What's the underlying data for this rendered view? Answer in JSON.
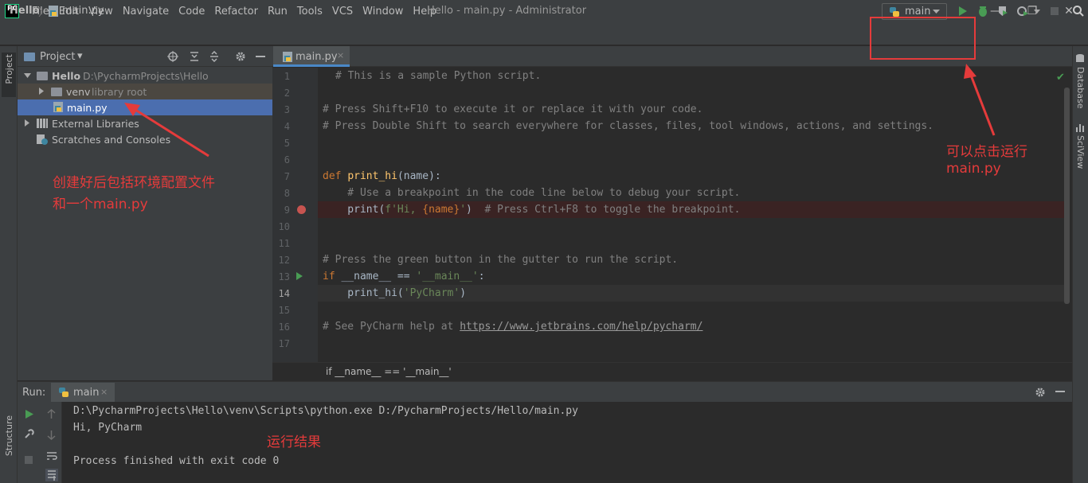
{
  "titlebar": {
    "app_logo": "PC",
    "menu": [
      "File",
      "Edit",
      "View",
      "Navigate",
      "Code",
      "Refactor",
      "Run",
      "Tools",
      "VCS",
      "Window",
      "Help"
    ],
    "window_title": "Hello - main.py - Administrator",
    "controls": {
      "minimize": "—",
      "restore": "❐",
      "close": "✕"
    }
  },
  "navbar": {
    "project": "Hello",
    "separator": "〉",
    "file": "main.py",
    "run_config": "main",
    "toolbar_icons": [
      "run-icon",
      "debug-icon",
      "coverage-icon",
      "profile-icon",
      "stop-icon",
      "search-icon"
    ]
  },
  "left_stripe": {
    "project": "Project",
    "structure": "Structure"
  },
  "project_panel": {
    "title": "Project",
    "dropdown": "▾",
    "tree": {
      "root_name": "Hello",
      "root_path": "D:\\PycharmProjects\\Hello",
      "venv_name": "venv",
      "venv_note": "library root",
      "main_file": "main.py",
      "external": "External Libraries",
      "scratches": "Scratches and Consoles"
    }
  },
  "editor": {
    "tab": "main.py",
    "tab_close": "×",
    "line_numbers": [
      "1",
      "2",
      "3",
      "4",
      "5",
      "6",
      "7",
      "8",
      "9",
      "10",
      "11",
      "12",
      "13",
      "14",
      "15",
      "16",
      "17"
    ],
    "lines": {
      "l1": "# This is a sample Python script.",
      "l3": "# Press Shift+F10 to execute it or replace it with your code.",
      "l4": "# Press Double Shift to search everywhere for classes, files, tool windows, actions, and settings.",
      "l7_kw": "def",
      "l7_fn": "print_hi",
      "l7_rest": "(name):",
      "l8": "    # Use a breakpoint in the code line below to debug your script.",
      "l9_call": "    print(",
      "l9_str1": "f'Hi, ",
      "l9_var": "{name}",
      "l9_str2": "'",
      "l9_close": ")  ",
      "l9_cmt": "# Press Ctrl+F8 to toggle the breakpoint.",
      "l12": "# Press the green button in the gutter to run the script.",
      "l13_kw": "if",
      "l13_rest": " __name__ == ",
      "l13_str": "'__main__'",
      "l13_colon": ":",
      "l14_call": "    print_hi(",
      "l14_str": "'PyCharm'",
      "l14_close": ")",
      "l16_cmt": "# See PyCharm help at ",
      "l16_link": "https://www.jetbrains.com/help/pycharm/"
    },
    "breadcrumb": "if __name__ == '__main__'",
    "status_check": "✔"
  },
  "right_stripe": {
    "database": "Database",
    "sciview": "SciView"
  },
  "run_panel": {
    "label": "Run:",
    "tab": "main",
    "tab_close": "×",
    "console": {
      "cmd": "D:\\PycharmProjects\\Hello\\venv\\Scripts\\python.exe D:/PycharmProjects/Hello/main.py",
      "output": "Hi, PyCharm",
      "exit": "Process finished with exit code 0"
    }
  },
  "annotations": {
    "run_hint_1": "可以点击运行",
    "run_hint_2": "main.py",
    "env_hint_1": "创建好后包括环境配置文件",
    "env_hint_2": "和一个main.py",
    "result_hint": "运行结果",
    "color": "#e53b3b"
  }
}
